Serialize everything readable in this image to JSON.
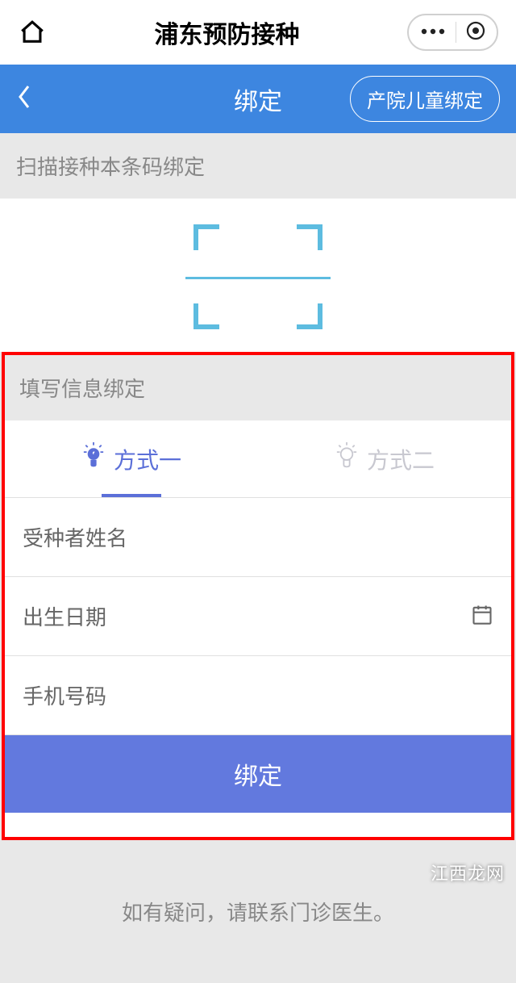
{
  "system": {
    "title": "浦东预防接种"
  },
  "nav": {
    "title": "绑定",
    "right_button": "产院儿童绑定"
  },
  "scan": {
    "header": "扫描接种本条码绑定"
  },
  "fill": {
    "header": "填写信息绑定",
    "tabs": [
      {
        "label": "方式一"
      },
      {
        "label": "方式二"
      }
    ],
    "fields": {
      "name": "受种者姓名",
      "birth": "出生日期",
      "phone": "手机号码"
    },
    "submit": "绑定"
  },
  "help": "如有疑问，请联系门诊医生。",
  "watermark": "江西龙网"
}
